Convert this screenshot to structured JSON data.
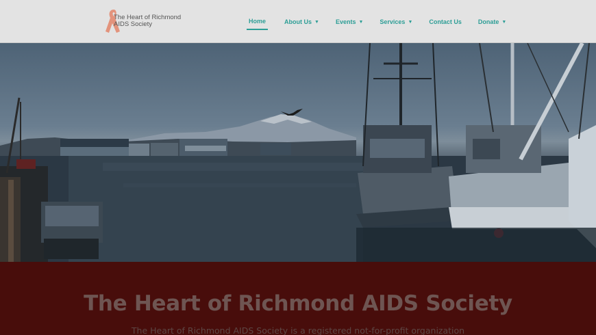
{
  "site": {
    "logo_line1": "The Heart of Richmond",
    "logo_line2": "AIDS Society"
  },
  "nav": {
    "items": [
      {
        "label": "Home",
        "active": true,
        "dropdown": false
      },
      {
        "label": "About Us",
        "active": false,
        "dropdown": true
      },
      {
        "label": "Events",
        "active": false,
        "dropdown": true
      },
      {
        "label": "Services",
        "active": false,
        "dropdown": true
      },
      {
        "label": "Contact Us",
        "active": false,
        "dropdown": false
      },
      {
        "label": "Donate",
        "active": false,
        "dropdown": true
      }
    ],
    "chevron": "⌄"
  },
  "hero": {
    "image": "harbor-fishing-boats-mountain"
  },
  "banner": {
    "title": "The Heart of Richmond AIDS Society",
    "subtitle": "The Heart of Richmond AIDS Society is a registered not-for-profit organization"
  },
  "colors": {
    "accent": "#2d9e96",
    "banner": "#480d0b",
    "ribbon": "#e3937c"
  }
}
